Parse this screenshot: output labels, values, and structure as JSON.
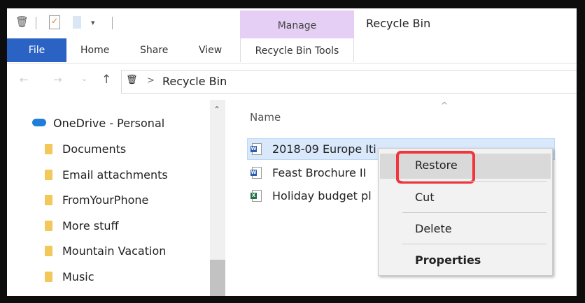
{
  "window_title": "Recycle Bin",
  "ribbon": {
    "manage_label": "Manage",
    "tabs": [
      "File",
      "Home",
      "Share",
      "View"
    ],
    "contextual_tab": "Recycle Bin Tools"
  },
  "address": {
    "separator": ">",
    "path": "Recycle Bin"
  },
  "nav": {
    "items": [
      {
        "label": "OneDrive - Personal",
        "icon": "cloud-icon"
      },
      {
        "label": "Documents"
      },
      {
        "label": "Email attachments"
      },
      {
        "label": "FromYourPhone"
      },
      {
        "label": "More stuff"
      },
      {
        "label": "Mountain Vacation"
      },
      {
        "label": "Music"
      }
    ]
  },
  "content": {
    "column_header": "Name",
    "files": [
      {
        "name": "2018-09 Europe Iti",
        "type": "word",
        "selected": true
      },
      {
        "name": "Feast Brochure II",
        "type": "word"
      },
      {
        "name": "Holiday budget pl",
        "type": "excel"
      }
    ]
  },
  "context_menu": {
    "items": [
      "Restore",
      "Cut",
      "Delete",
      "Properties"
    ],
    "highlighted": "Restore"
  },
  "colors": {
    "file_tab": "#2b63c4",
    "manage": "#e6cff5",
    "highlight": "#f0353c"
  }
}
